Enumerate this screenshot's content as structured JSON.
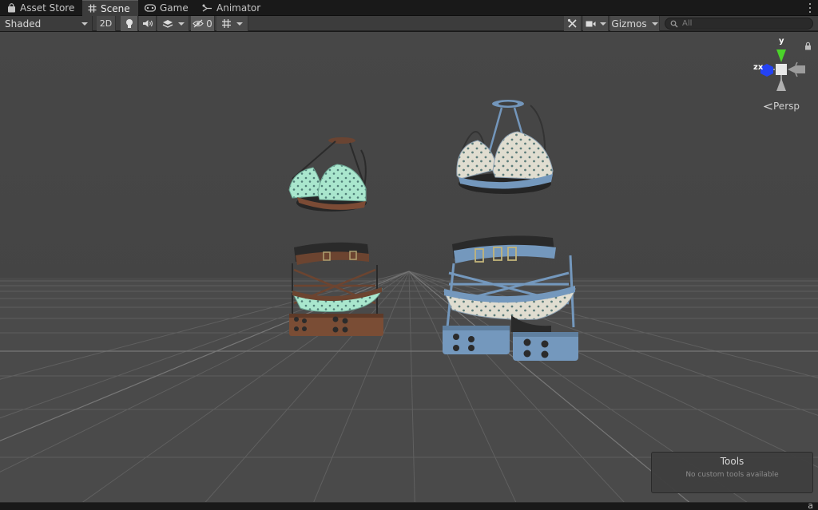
{
  "tabs": [
    {
      "label": "Asset Store",
      "icon": "shopping-bag-icon",
      "active": false
    },
    {
      "label": "Scene",
      "icon": "grid-hash-icon",
      "active": true
    },
    {
      "label": "Game",
      "icon": "gamepad-icon",
      "active": false
    },
    {
      "label": "Animator",
      "icon": "animator-icon",
      "active": false
    }
  ],
  "toolbar": {
    "draw_mode": "Shaded",
    "toggle_2d": "2D",
    "hidden_count": "0",
    "gizmos_label": "Gizmos",
    "search_placeholder": "All"
  },
  "gizmo": {
    "y_label": "y",
    "zx_label": "zx",
    "projection": "Persp"
  },
  "tools_overlay": {
    "title": "Tools",
    "subtitle": "No custom tools available"
  },
  "bottom_glyph": "a",
  "colors": {
    "scene_background": "#464646",
    "ground": "#4b4b4b",
    "grid_line": "#6e6e6e",
    "mint_fabric": "#a7e4cb",
    "cream_fabric": "#dddbcd",
    "brown_strap": "#6e4330",
    "blue_strap": "#7498bd",
    "gizmo_y": "#4bd32a",
    "gizmo_z": "#2442f4"
  }
}
